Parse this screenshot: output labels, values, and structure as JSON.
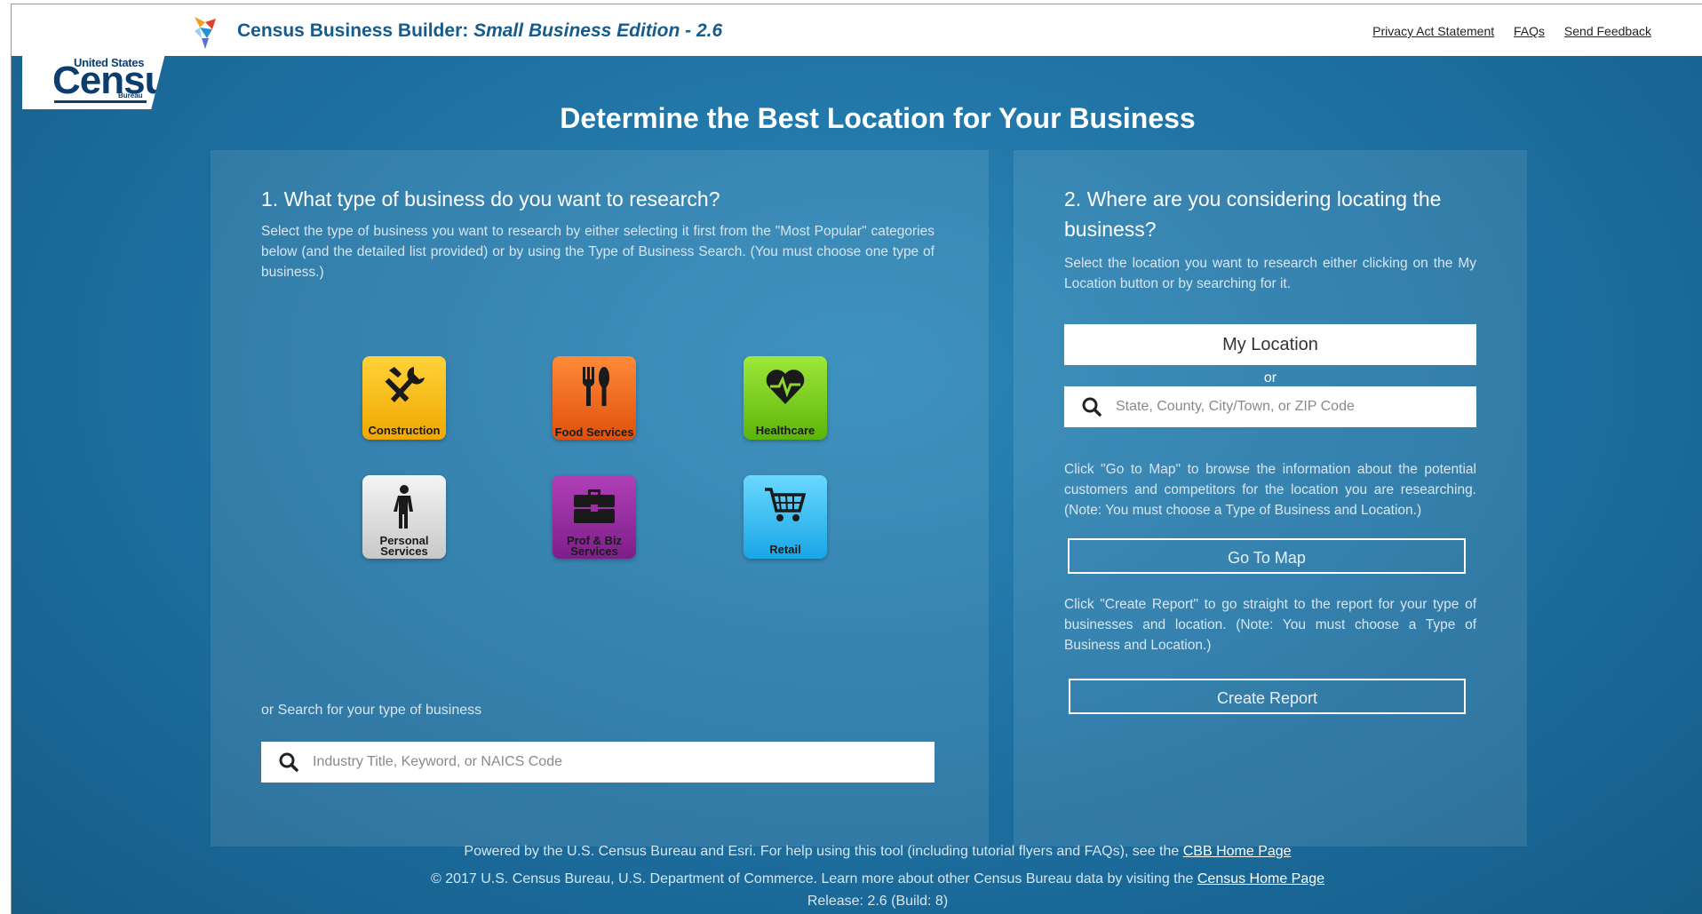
{
  "header": {
    "logo": {
      "top": "United States",
      "main": "Census",
      "sub": "Bureau"
    },
    "title_main": "Census Business Builder: ",
    "title_italic": "Small Business Edition - 2.6",
    "links": [
      "Privacy Act Statement",
      "FAQs",
      "Send Feedback"
    ]
  },
  "page_title": "Determine the Best Location for Your Business",
  "left_panel": {
    "heading": "1. What type of business do you want to research?",
    "description": "Select the type of business you want to research by either selecting it first from the \"Most Popular\" categories below (and the detailed list provided) or by using the Type of Business Search. (You must choose one type of business.)",
    "tiles": [
      {
        "label": "Construction",
        "icon": "tools-icon",
        "color": "#f7b400"
      },
      {
        "label": "Food Services",
        "icon": "fork-knife-icon",
        "color": "#f26a1b"
      },
      {
        "label": "Healthcare",
        "icon": "heart-pulse-icon",
        "color": "#7dcc1e"
      },
      {
        "label": "Personal Services",
        "icon": "person-icon",
        "color": "#dcdcdc"
      },
      {
        "label": "Prof & Biz Services",
        "icon": "briefcase-icon",
        "color": "#9a2ca4"
      },
      {
        "label": "Retail",
        "icon": "cart-icon",
        "color": "#3bbcf4"
      }
    ],
    "search_label": "or Search for your type of business",
    "search_placeholder": "Industry Title, Keyword, or NAICS Code"
  },
  "right_panel": {
    "heading": "2. Where are you considering locating the business?",
    "description": "Select the location you want to research either clicking on the My Location button or by searching for it.",
    "my_location_label": "My Location",
    "or_label": "or",
    "location_placeholder": "State, County, City/Town, or ZIP Code",
    "map_description": "Click \"Go to Map\" to browse the information about the potential customers and competitors for the location you are researching. (Note: You must choose a Type of Business and Location.)",
    "go_to_map_label": "Go To Map",
    "report_description": "Click \"Create Report\" to go straight to the report for your type of businesses and location. (Note: You must choose a Type of Business and Location.)",
    "create_report_label": "Create Report"
  },
  "footer": {
    "line1_text": "Powered by the U.S. Census Bureau and Esri. For help using this tool (including tutorial flyers and FAQs), see the ",
    "line1_link": "CBB Home Page",
    "line2_text": "© 2017 U.S. Census Bureau, U.S. Department of Commerce. Learn more about other Census Bureau data by visiting the ",
    "line2_link": "Census Home Page",
    "release": "Release: 2.6 (Build: 8)"
  }
}
